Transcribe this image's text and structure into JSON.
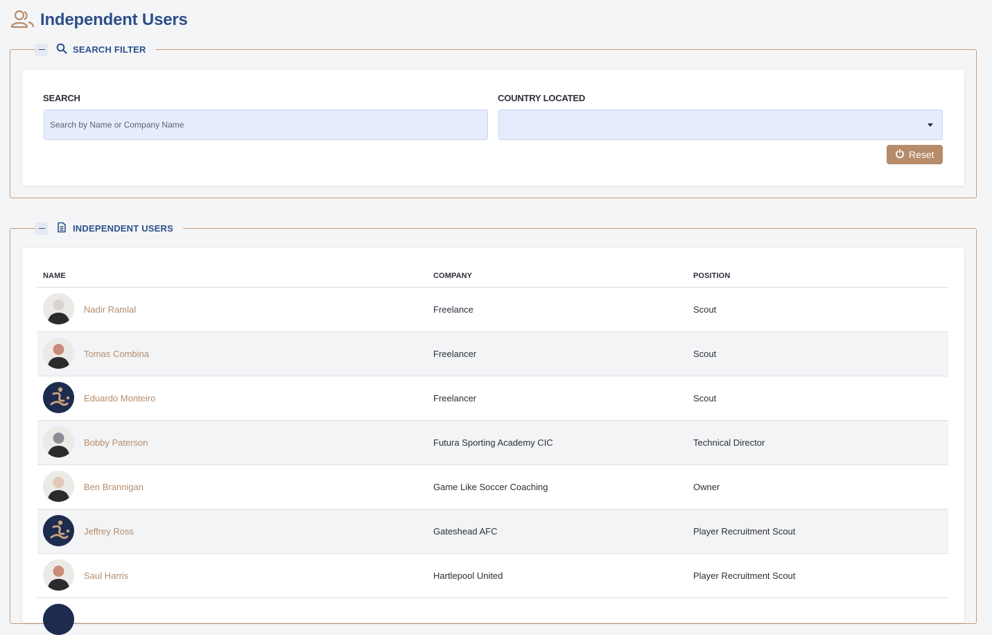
{
  "page": {
    "title": "Independent Users",
    "icon": "users-icon"
  },
  "search_panel": {
    "legend": "SEARCH FILTER",
    "icon": "search-icon",
    "search": {
      "label": "SEARCH",
      "value": "",
      "placeholder": "Search by Name or Company Name"
    },
    "country": {
      "label": "COUNTRY LOCATED",
      "selected": ""
    },
    "reset_label": "Reset"
  },
  "users_panel": {
    "legend": "INDEPENDENT USERS",
    "icon": "document-icon",
    "columns": {
      "name": "NAME",
      "company": "COMPANY",
      "position": "POSITION"
    },
    "rows": [
      {
        "name": "Nadir Ramlal",
        "company": "Freelance",
        "position": "Scout",
        "avatar": "photo"
      },
      {
        "name": "Tomas Combina",
        "company": "Freelancer",
        "position": "Scout",
        "avatar": "photo"
      },
      {
        "name": "Eduardo Monteiro",
        "company": "Freelancer",
        "position": "Scout",
        "avatar": "logo"
      },
      {
        "name": "Bobby Paterson",
        "company": "Futura Sporting Academy CIC",
        "position": "Technical Director",
        "avatar": "photo"
      },
      {
        "name": "Ben Brannigan",
        "company": "Game Like Soccer Coaching",
        "position": "Owner",
        "avatar": "photo"
      },
      {
        "name": "Jeffrey Ross",
        "company": "Gateshead AFC",
        "position": "Player Recruitment Scout",
        "avatar": "logo"
      },
      {
        "name": "Saul Harris",
        "company": "Hartlepool United",
        "position": "Player Recruitment Scout",
        "avatar": "photo"
      }
    ]
  },
  "colors": {
    "accent": "#b68c6b",
    "brand": "#2c4f8a",
    "input_bg": "#e6ecfc"
  }
}
